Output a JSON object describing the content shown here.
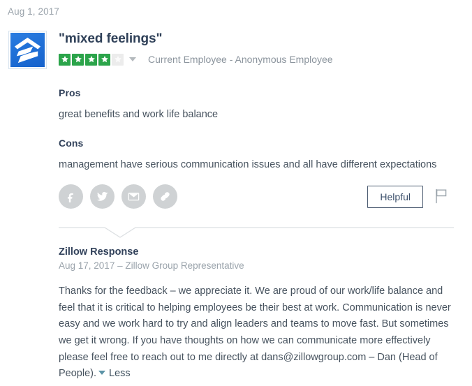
{
  "review": {
    "date": "Aug 1, 2017",
    "title": "\"mixed feelings\"",
    "rating": {
      "value": 4,
      "max": 5,
      "filled_color": "#2ba44a",
      "empty_color": "#ececec",
      "caret_icon": "chevron-down-icon"
    },
    "employee_status": "Current Employee - Anonymous Employee",
    "company_logo": {
      "icon": "zillow-logo-icon",
      "background_color": "#2a7de1"
    },
    "pros": {
      "label": "Pros",
      "text": "great benefits and work life balance"
    },
    "cons": {
      "label": "Cons",
      "text": "management have serious communication issues and all have different expectations"
    }
  },
  "actions": {
    "share": [
      {
        "icon": "facebook-icon",
        "name": "share-facebook"
      },
      {
        "icon": "twitter-icon",
        "name": "share-twitter"
      },
      {
        "icon": "email-icon",
        "name": "share-email"
      },
      {
        "icon": "link-icon",
        "name": "share-link"
      }
    ],
    "helpful_label": "Helpful",
    "flag_icon": "flag-icon",
    "share_icon_color": "#cfd2d4"
  },
  "response": {
    "title": "Zillow Response",
    "meta": "Aug 17, 2017 – Zillow Group Representative",
    "body": "Thanks for the feedback – we appreciate it. We are proud of our work/life balance and feel that it is critical to helping employees be their best at work. Communication is never easy and we work hard to try and align leaders and teams to move fast. But sometimes we get it wrong. If you have thoughts on how we can communicate more effectively please feel free to reach out to me directly at dans@zillowgroup.com – Dan (Head of People).",
    "toggle_label": "Less",
    "toggle_icon": "caret-down-icon",
    "toggle_color": "#5b93a6"
  }
}
